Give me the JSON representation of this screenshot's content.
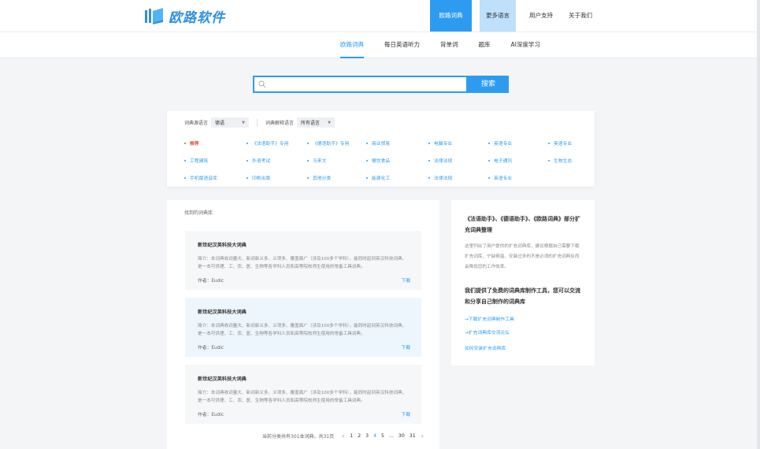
{
  "brand": {
    "name": "欧路软件",
    "accent": "#2d9cf0",
    "logo_color": "#2d8fe1"
  },
  "topnav": [
    {
      "label": "欧路词典",
      "state": "active"
    },
    {
      "label": "更多语言",
      "state": "more"
    },
    {
      "label": "用户支持",
      "state": ""
    },
    {
      "label": "关于我们",
      "state": ""
    }
  ],
  "subnav": [
    {
      "label": "欧路词典",
      "active": true
    },
    {
      "label": "每日英语听力",
      "active": false
    },
    {
      "label": "背单词",
      "active": false
    },
    {
      "label": "题库",
      "active": false
    },
    {
      "label": "AI深度学习",
      "active": false
    }
  ],
  "search": {
    "placeholder": "",
    "button_label": "搜索",
    "icon": "search-icon"
  },
  "filter": {
    "source_label": "词典源语言",
    "source_value": "德语",
    "target_label": "词典解释语言",
    "target_value": "所有语言",
    "categories": [
      "推荐",
      "《法语助手》专用",
      "《德语助手》专用",
      "商业贸易",
      "电脑专业",
      "英语专业",
      "英语专业",
      "工程建筑",
      "外语考试",
      "马来文",
      "餐饮食品",
      "法律法规",
      "电子通讯",
      "生物生态",
      "手机版语音库",
      "印刷出版",
      "其他分类",
      "能源化工",
      "法律法规",
      "英语专业"
    ]
  },
  "results": {
    "title": "找到的词典库",
    "cards": [
      {
        "title": "新世纪汉英科技大词典",
        "desc": "简介：本词典收词量大、新词新义多、义项多、覆盖面广（涉及100多个学科），能同时起到英汉科技词典，是一本可供理、工、农、医、生物等各学科人员和高等院校师生使用的常备工具词典。",
        "author": "作者：Eudic",
        "download": "下载",
        "highlight": false
      },
      {
        "title": "新世纪汉英科技大词典",
        "desc": "简介：本词典收词量大、新词新义多、义项多、覆盖面广（涉及100多个学科），能同时起到英汉科技词典，是一本可供理、工、农、医、生物等各学科人员和高等院校师生使用的常备工具词典。",
        "author": "作者：Eudic",
        "download": "下载",
        "highlight": true
      },
      {
        "title": "新世纪汉英科技大词典",
        "desc": "简介：本词典收词量大、新词新义多、义项多、覆盖面广（涉及100多个学科），能同时起到英汉科技词典，是一本可供理、工、农、医、生物等各学科人员和高等院校师生使用的常备工具词典。",
        "author": "作者：Eudic",
        "download": "下载",
        "highlight": false
      }
    ],
    "pagination": {
      "info": "当前分类共有301本词典，共31页",
      "pages": [
        "1",
        "2",
        "3",
        "4",
        "5",
        "...",
        "30",
        "31"
      ],
      "current": "4"
    }
  },
  "sidebar": {
    "title": "《法语助手》、《德语助手》、《欧路词典》部分扩充词典整理",
    "desc": "这里列出了用户提供的扩充词典库，建议根据自己需要下载扩充词库，宁缺毋滥，安装过多的不是必须的扩充词典反而会降低您的工作效率。",
    "title2": "我们提供了免费的词典库制作工具，您可以交流和分享自己制作的词典库",
    "links": [
      "→下载扩充词典制作工具",
      "→扩充词典库交流论坛",
      "如何安装扩充词典库"
    ]
  }
}
